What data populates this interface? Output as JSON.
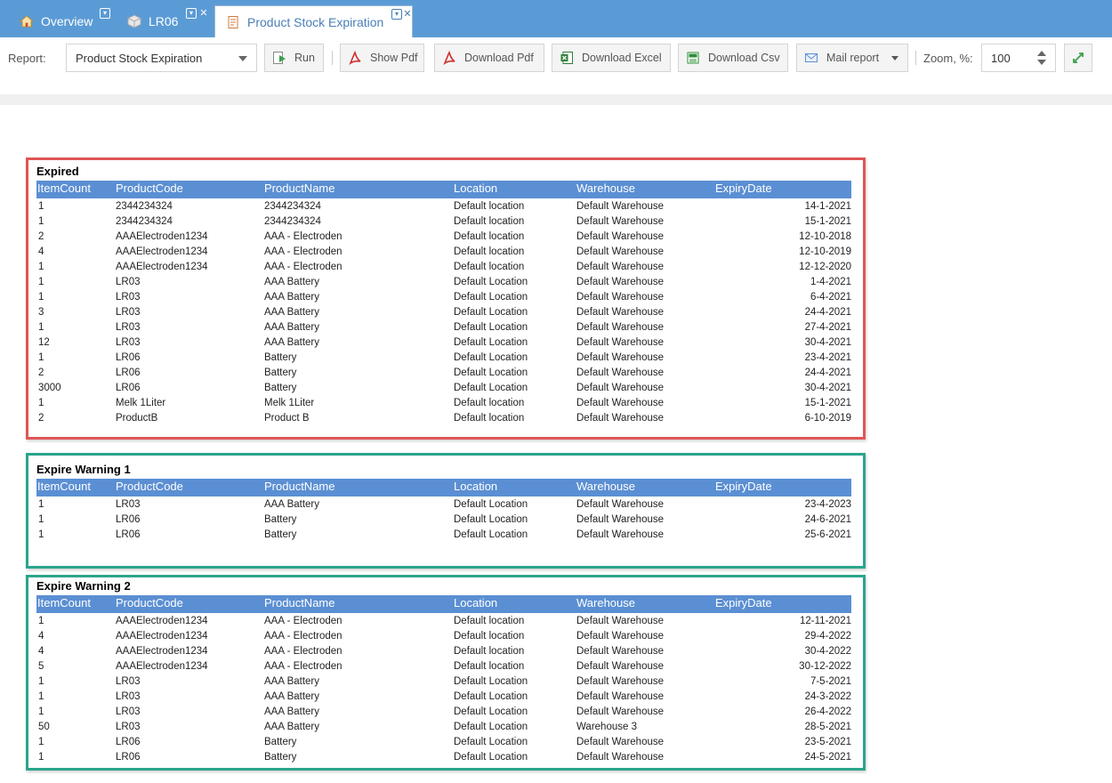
{
  "tabs": [
    {
      "label": "Overview",
      "icon": "home-icon"
    },
    {
      "label": "LR06",
      "icon": "box-icon"
    },
    {
      "label": "Product Stock Expiration",
      "icon": "report-icon"
    }
  ],
  "toolbar": {
    "report_label": "Report:",
    "report_value": "Product Stock Expiration",
    "run": "Run",
    "show_pdf": "Show Pdf",
    "download_pdf": "Download Pdf",
    "download_excel": "Download Excel",
    "download_csv": "Download Csv",
    "mail_report": "Mail report",
    "zoom_label": "Zoom, %:",
    "zoom_value": "100"
  },
  "columns": [
    "ItemCount",
    "ProductCode",
    "ProductName",
    "Location",
    "Warehouse",
    "ExpiryDate"
  ],
  "sections": [
    {
      "title": "Expired",
      "rows": [
        [
          "1",
          "2344234324",
          "2344234324",
          "Default location",
          "Default Warehouse",
          "14-1-2021"
        ],
        [
          "1",
          "2344234324",
          "2344234324",
          "Default location",
          "Default Warehouse",
          "15-1-2021"
        ],
        [
          "2",
          "AAAElectroden1234",
          "AAA - Electroden",
          "Default location",
          "Default Warehouse",
          "12-10-2018"
        ],
        [
          "4",
          "AAAElectroden1234",
          "AAA - Electroden",
          "Default location",
          "Default Warehouse",
          "12-10-2019"
        ],
        [
          "1",
          "AAAElectroden1234",
          "AAA - Electroden",
          "Default location",
          "Default Warehouse",
          "12-12-2020"
        ],
        [
          "1",
          "LR03",
          "AAA Battery",
          "Default Location",
          "Default Warehouse",
          "1-4-2021"
        ],
        [
          "1",
          "LR03",
          "AAA Battery",
          "Default Location",
          "Default Warehouse",
          "6-4-2021"
        ],
        [
          "3",
          "LR03",
          "AAA Battery",
          "Default Location",
          "Default Warehouse",
          "24-4-2021"
        ],
        [
          "1",
          "LR03",
          "AAA Battery",
          "Default Location",
          "Default Warehouse",
          "27-4-2021"
        ],
        [
          "12",
          "LR03",
          "AAA Battery",
          "Default Location",
          "Default Warehouse",
          "30-4-2021"
        ],
        [
          "1",
          "LR06",
          "Battery",
          "Default Location",
          "Default Warehouse",
          "23-4-2021"
        ],
        [
          "2",
          "LR06",
          "Battery",
          "Default Location",
          "Default Warehouse",
          "24-4-2021"
        ],
        [
          "3000",
          "LR06",
          "Battery",
          "Default Location",
          "Default Warehouse",
          "30-4-2021"
        ],
        [
          "1",
          "Melk 1Liter",
          "Melk 1Liter",
          "Default location",
          "Default Warehouse",
          "15-1-2021"
        ],
        [
          "2",
          "ProductB",
          "Product B",
          "Default location",
          "Default Warehouse",
          "6-10-2019"
        ]
      ]
    },
    {
      "title": "Expire Warning 1",
      "rows": [
        [
          "1",
          "LR03",
          "AAA Battery",
          "Default Location",
          "Default Warehouse",
          "23-4-2023"
        ],
        [
          "1",
          "LR06",
          "Battery",
          "Default Location",
          "Default Warehouse",
          "24-6-2021"
        ],
        [
          "1",
          "LR06",
          "Battery",
          "Default Location",
          "Default Warehouse",
          "25-6-2021"
        ]
      ]
    },
    {
      "title": "Expire Warning 2",
      "rows": [
        [
          "1",
          "AAAElectroden1234",
          "AAA - Electroden",
          "Default location",
          "Default Warehouse",
          "12-11-2021"
        ],
        [
          "4",
          "AAAElectroden1234",
          "AAA - Electroden",
          "Default location",
          "Default Warehouse",
          "29-4-2022"
        ],
        [
          "4",
          "AAAElectroden1234",
          "AAA - Electroden",
          "Default location",
          "Default Warehouse",
          "30-4-2022"
        ],
        [
          "5",
          "AAAElectroden1234",
          "AAA - Electroden",
          "Default location",
          "Default Warehouse",
          "30-12-2022"
        ],
        [
          "1",
          "LR03",
          "AAA Battery",
          "Default Location",
          "Default Warehouse",
          "7-5-2021"
        ],
        [
          "1",
          "LR03",
          "AAA Battery",
          "Default Location",
          "Default Warehouse",
          "24-3-2022"
        ],
        [
          "1",
          "LR03",
          "AAA Battery",
          "Default Location",
          "Default Warehouse",
          "26-4-2022"
        ],
        [
          "50",
          "LR03",
          "AAA Battery",
          "Default Location",
          "Warehouse 3",
          "28-5-2021"
        ],
        [
          "1",
          "LR06",
          "Battery",
          "Default Location",
          "Default Warehouse",
          "23-5-2021"
        ],
        [
          "1",
          "LR06",
          "Battery",
          "Default Location",
          "Default Warehouse",
          "24-5-2021"
        ]
      ]
    }
  ]
}
